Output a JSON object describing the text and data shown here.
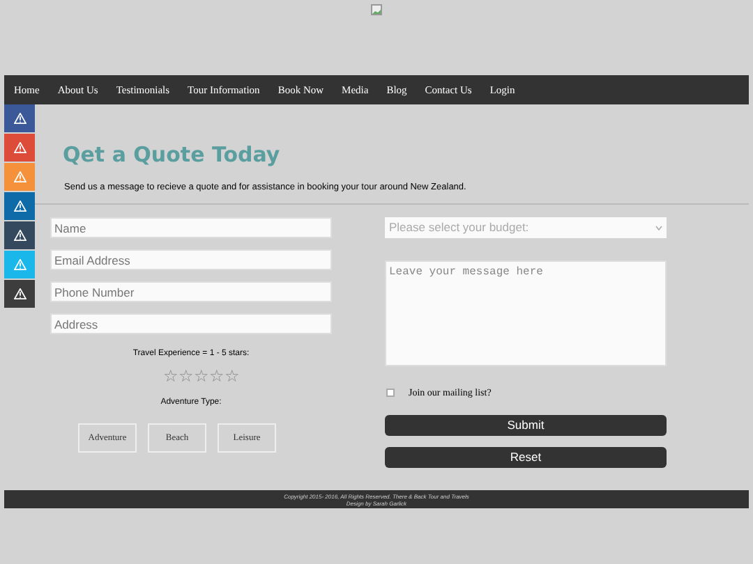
{
  "nav": [
    {
      "label": "Home"
    },
    {
      "label": "About Us"
    },
    {
      "label": "Testimonials"
    },
    {
      "label": "Tour Information"
    },
    {
      "label": "Book Now"
    },
    {
      "label": "Media"
    },
    {
      "label": "Blog"
    },
    {
      "label": "Contact Us"
    },
    {
      "label": "Login"
    }
  ],
  "social": [
    {
      "color": "#3b5998"
    },
    {
      "color": "#dd4b39"
    },
    {
      "color": "#f4913a"
    },
    {
      "color": "#0e6ba8"
    },
    {
      "color": "#34495e"
    },
    {
      "color": "#1ab7ea"
    },
    {
      "color": "#3d3d3d"
    }
  ],
  "title": "Qet a Quote Today",
  "intro": "Send us a message to recieve a quote and for assistance in booking your tour around New Zealand.",
  "fields": [
    {
      "placeholder": "Name"
    },
    {
      "placeholder": "Email Address"
    },
    {
      "placeholder": "Phone Number"
    },
    {
      "placeholder": "Address"
    }
  ],
  "rating": {
    "label": "Travel Experience = 1 - 5 stars:",
    "stars": 0
  },
  "adventure": {
    "label": "Adventure Type:",
    "options": [
      {
        "label": "Adventure"
      },
      {
        "label": "Beach"
      },
      {
        "label": "Leisure"
      }
    ]
  },
  "budget": {
    "placeholder": "Please select your budget:"
  },
  "message": {
    "placeholder": "Leave your message here"
  },
  "mailing": {
    "label": "Join our mailing list?",
    "checked": false
  },
  "buttons": [
    {
      "label": "Submit"
    },
    {
      "label": "Reset"
    }
  ],
  "footer": [
    "Copyright 2015- 2016, All Rights Reserved. There & Back Tour and Travels",
    "Design by Sarah Garlick"
  ]
}
